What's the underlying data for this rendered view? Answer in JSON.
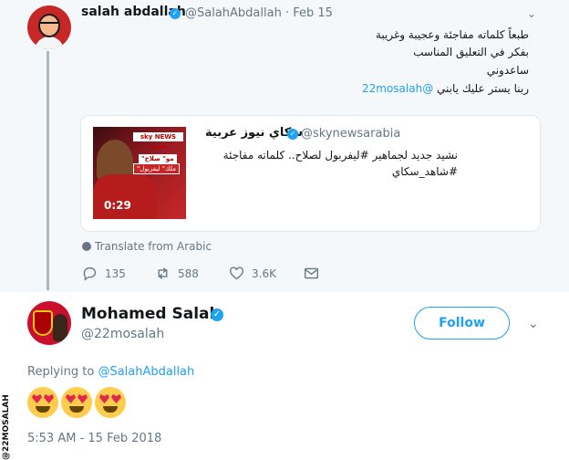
{
  "tweet1": {
    "name": "salah abdallah",
    "handle_date": "@SalahAbdallah · Feb 15",
    "lines": [
      "طبعاً كلماته مفاجئة وعجيبة وغريبة",
      "بفكر في التعليق المناسب",
      "ساعدوني"
    ],
    "line4_text": "ربنا يستر عليك يابني ",
    "line4_mention": "@22mosalah"
  },
  "quote": {
    "name": "سكاي نيوز عربية",
    "handle": "@skynewsarabia",
    "text_line1": "نشيد جديد لجماهير #ليفربول لصلاح.. كلماته مفاجئة",
    "text_line2": "#شاهد_سكاي",
    "thumb_logo": "sky NEWS عربية",
    "thumb_tag1": "\"مو\" صلاح",
    "thumb_tag2": "\"ملك\" ليفربول",
    "duration": "0:29"
  },
  "translate_label": "Translate from Arabic",
  "actions": {
    "replies": "135",
    "retweets": "588",
    "likes": "3.6K"
  },
  "tweet2": {
    "name": "Mohamed Salah",
    "handle": "@22mosalah",
    "follow_label": "Follow",
    "replying_prefix": "Replying to ",
    "replying_mention": "@SalahAbdallah",
    "timestamp": "5:53 AM - 15 Feb 2018"
  },
  "watermark": "@22MOSALAH",
  "colors": {
    "accent": "#1da1f2",
    "muted": "#657786",
    "top_bg": "#f5f8fa"
  }
}
